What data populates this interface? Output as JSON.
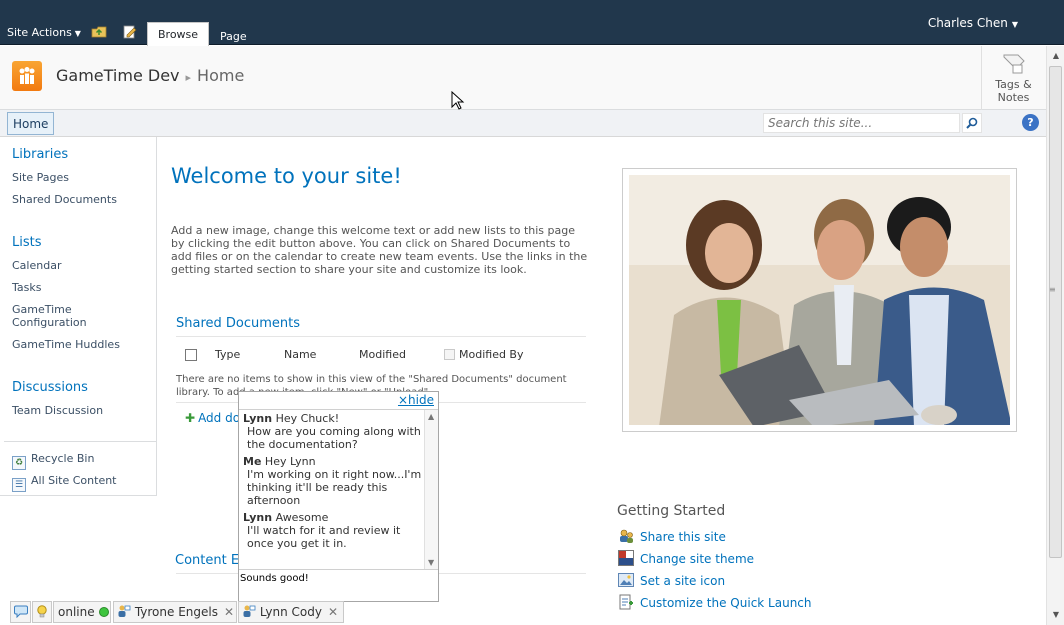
{
  "ribbon": {
    "site_actions": "Site Actions",
    "tabs": [
      {
        "label": "Browse"
      },
      {
        "label": "Page"
      }
    ],
    "user": "Charles Chen"
  },
  "title_area": {
    "site_name": "GameTime Dev",
    "current_page": "Home",
    "tags_notes": "Tags &\nNotes"
  },
  "topbar": {
    "home_tab": "Home",
    "search_placeholder": "Search this site...",
    "help": "?"
  },
  "quicklaunch": {
    "libraries_heading": "Libraries",
    "libraries": [
      "Site Pages",
      "Shared Documents"
    ],
    "lists_heading": "Lists",
    "lists": [
      "Calendar",
      "Tasks",
      "GameTime\nConfiguration",
      "GameTime Huddles"
    ],
    "discussions_heading": "Discussions",
    "discussions": [
      "Team Discussion"
    ],
    "recycle_bin": "Recycle Bin",
    "all_site_content": "All Site Content"
  },
  "main": {
    "welcome_title": "Welcome to your site!",
    "welcome_text": "Add a new image, change this welcome text or add new lists to this page by clicking the edit button above. You can click on Shared Documents to add files or on the calendar to create new team events. Use the links in the getting started section to share your site and customize its look.",
    "shared_docs": {
      "title": "Shared Documents",
      "columns": [
        "Type",
        "Name",
        "Modified",
        "Modified By"
      ],
      "empty_text": "There are no items to show in this view of the \"Shared Documents\" document library. To add a new item, click \"New\" or \"Upload\".",
      "add_document": "Add document"
    },
    "content_editor_title": "Content Editor"
  },
  "getting_started": {
    "title": "Getting Started",
    "items": [
      {
        "label": "Share this site",
        "icon": "share-site-icon"
      },
      {
        "label": "Change site theme",
        "icon": "theme-icon"
      },
      {
        "label": "Set a site icon",
        "icon": "site-icon-icon"
      },
      {
        "label": "Customize the Quick Launch",
        "icon": "quick-launch-icon"
      }
    ]
  },
  "chat": {
    "hide_label": "hide",
    "messages": [
      {
        "from": "Lynn",
        "first": "Hey Chuck!",
        "rest": "How are you coming along with the documentation?"
      },
      {
        "from": "Me",
        "first": "Hey Lynn",
        "rest": "I'm working on it right now...I'm thinking it'll be ready this afternoon"
      },
      {
        "from": "Lynn",
        "first": "Awesome",
        "rest": "I'll watch for it and review it once you get it in."
      }
    ],
    "input_value": "Sounds good!"
  },
  "chatbar": {
    "status": "online",
    "contacts": [
      "Tyrone Engels",
      "Lynn Cody"
    ]
  }
}
